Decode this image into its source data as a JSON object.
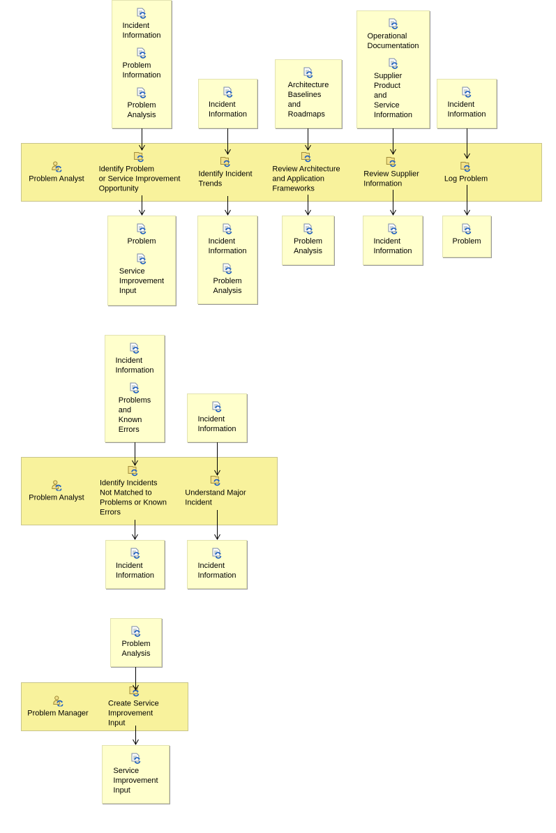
{
  "colors": {
    "band": "#F8F29C",
    "artifact_box": "#FFFFCC",
    "icon_blue": "#1f5fbf"
  },
  "diagrams": [
    {
      "role": "Problem Analyst",
      "tasks": [
        {
          "name": "Identify Problem\nor Service Improvement\nOpportunity",
          "inputs": [
            "Incident\nInformation",
            "Problem\nInformation",
            "Problem\nAnalysis"
          ],
          "outputs": [
            "Problem",
            "Service\nImprovement\nInput"
          ]
        },
        {
          "name": "Identify Incident\nTrends",
          "inputs": [
            "Incident\nInformation"
          ],
          "outputs": [
            "Incident\nInformation",
            "Problem\nAnalysis"
          ]
        },
        {
          "name": "Review Architecture\nand Application\nFrameworks",
          "inputs": [
            "Architecture\nBaselines\nand\nRoadmaps"
          ],
          "outputs": [
            "Problem\nAnalysis"
          ]
        },
        {
          "name": "Review Supplier\nInformation",
          "inputs": [
            "Operational\nDocumentation",
            "Supplier\nProduct\nand\nService\nInformation"
          ],
          "outputs": [
            "Incident\nInformation"
          ]
        },
        {
          "name": "Log Problem",
          "inputs": [
            "Incident\nInformation"
          ],
          "outputs": [
            "Problem"
          ]
        }
      ]
    },
    {
      "role": "Problem Analyst",
      "tasks": [
        {
          "name": "Identify Incidents\nNot Matched to\nProblems or Known\nErrors",
          "inputs": [
            "Incident\nInformation",
            "Problems\nand\nKnown\nErrors"
          ],
          "outputs": [
            "Incident\nInformation"
          ]
        },
        {
          "name": "Understand Major\nIncident",
          "inputs": [
            "Incident\nInformation"
          ],
          "outputs": [
            "Incident\nInformation"
          ]
        }
      ]
    },
    {
      "role": "Problem Manager",
      "tasks": [
        {
          "name": "Create Service\nImprovement Input",
          "inputs": [
            "Problem\nAnalysis"
          ],
          "outputs": [
            "Service\nImprovement\nInput"
          ]
        }
      ]
    }
  ]
}
